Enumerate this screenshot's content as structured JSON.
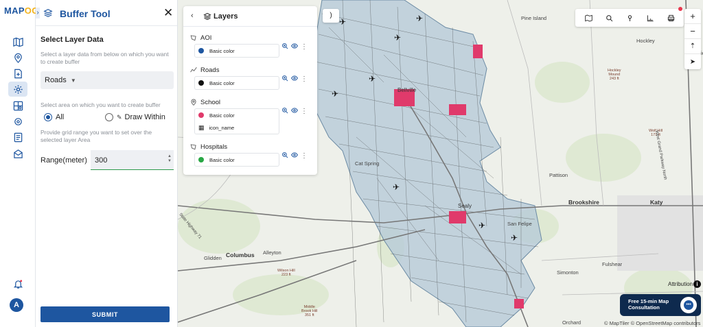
{
  "brand": {
    "logo_a": "MAP",
    "logo_b": "OG"
  },
  "rail": {
    "items": [
      {
        "icon": "map-icon"
      },
      {
        "icon": "location-pin-icon"
      },
      {
        "icon": "add-file-icon"
      },
      {
        "icon": "gear-icon"
      },
      {
        "icon": "map-analysis-icon"
      },
      {
        "icon": "settings-cog-icon"
      },
      {
        "icon": "report-icon"
      },
      {
        "icon": "share-map-icon"
      }
    ],
    "notification_icon": "bell-icon",
    "avatar_letter": "A"
  },
  "buffer_tool": {
    "title": "Buffer Tool",
    "close": "✕",
    "select_title": "Select Layer Data",
    "select_hint": "Select a layer data from below on which you want to create buffer",
    "selected_layer": "Roads",
    "area_hint": "Select area on which you want to create buffer",
    "option_all": "All",
    "option_draw": "Draw Within",
    "selected_option": "All",
    "grid_hint": "Provide grid range you want to set over the selected layer Area",
    "range_label": "Range(meter)",
    "range_value": "300",
    "submit_label": "SUBMIT"
  },
  "layers_panel": {
    "title": "Layers",
    "layers": [
      {
        "name": "AOI",
        "legend": [
          {
            "label": "Basic color",
            "color": "#1e56a0"
          }
        ]
      },
      {
        "name": "Roads",
        "legend": [
          {
            "label": "Basic color",
            "color": "#111111"
          }
        ]
      },
      {
        "name": "School",
        "legend": [
          {
            "label": "Basic color",
            "color": "#e03a6b"
          },
          {
            "label": "icon_name",
            "color": "#222222"
          }
        ]
      },
      {
        "name": "Hospitals",
        "legend": [
          {
            "label": "Basic color",
            "color": "#28a745"
          }
        ]
      }
    ]
  },
  "map": {
    "toggle_label": ")",
    "places": {
      "pine_island": "Pine Island",
      "hockley": "Hockley",
      "fairfie": "Fairfie",
      "hockley_mound": "Hockley\nMound\n243 ft",
      "wolf_hill": "Wolf Hill\n171 ft",
      "pattison": "Pattison",
      "brookshire": "Brookshire",
      "katy": "Katy",
      "cat_spring": "Cat Spring",
      "sealy": "Sealy",
      "san_felipe": "San Felipe",
      "bellville": "Bellville",
      "columbus": "Columbus",
      "alleyton": "Alleyton",
      "glidden": "Glidden",
      "wilson_hill": "Wilson Hill\n223 ft",
      "middle_brook_hill": "Middle\nBrook Hill\n351 ft",
      "simonton": "Simonton",
      "fulshear": "Fulshear",
      "orchard": "Orchard",
      "west_grand_parkway": "West Grand Parkway North",
      "state_highway_71": "State Highway 71"
    },
    "attribution": "Attribution",
    "consult_line1": "Free 15-min Map",
    "consult_line2": "Consultation",
    "copyright": "© MapTiler © OpenStreetMap contributors",
    "zoom_in": "+",
    "zoom_out": "−"
  }
}
